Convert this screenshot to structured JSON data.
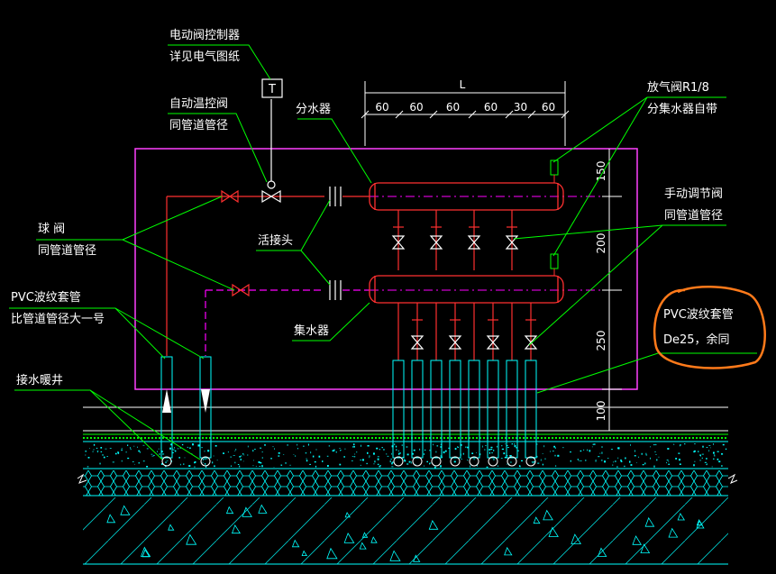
{
  "labels": {
    "motor_valve_controller": "电动阀控制器",
    "see_electrical": "详见电气图纸",
    "auto_temp_valve": "自动温控阀",
    "same_pipe_dia_1": "同管道管径",
    "distributor": "分水器",
    "air_vent": "放气阀R1/8",
    "manifold_included": "分集水器自带",
    "manual_valve": "手动调节阀",
    "same_pipe_dia_2": "同管道管径",
    "ball_valve": "球    阀",
    "same_pipe_dia_3": "同管道管径",
    "union": "活接头",
    "pvc_sleeve_left": "PVC波纹套管",
    "bigger_size": "比管道管径大一号",
    "collector": "集水器",
    "pvc_sleeve_right": "PVC波纹套管",
    "de25": "De25，余同",
    "drain_well": "接水暖井",
    "controller_box_symbol": "T"
  },
  "dimensions": {
    "overall": "L",
    "segments": [
      "60",
      "60",
      "60",
      "60",
      "30",
      "60"
    ],
    "vertical": [
      "150",
      "200",
      "250",
      "100"
    ]
  },
  "colors": {
    "background": "#000000",
    "text": "#ffffff",
    "leader": "#00ff00",
    "supply_pipe": "#ff3030",
    "return_pipe": "#ff00ff",
    "frame": "#ff40ff",
    "structure": "#00ffff",
    "highlight_circle": "#ff7a1a"
  }
}
